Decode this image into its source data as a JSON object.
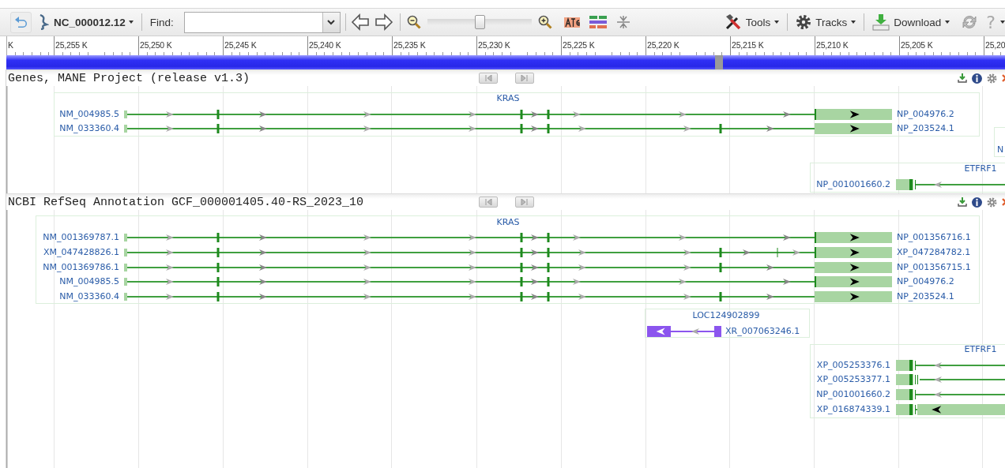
{
  "toolbar": {
    "sequence": "NC_000012.12",
    "find_label": "Find:",
    "zoom": {
      "level": 0.5
    },
    "menus": [
      "Tools",
      "Tracks",
      "Download"
    ],
    "help": "?"
  },
  "ruler": {
    "labels": [
      "K",
      "25,255 K",
      "25,250 K",
      "25,245 K",
      "25,240 K",
      "25,235 K",
      "25,230 K",
      "25,225 K",
      "25,220 K",
      "25,215 K",
      "25,210 K",
      "25,205 K",
      "25,20"
    ]
  },
  "tracks": [
    {
      "title": "Genes, MANE Project (release v1.3)",
      "genes": [
        {
          "name": "KRAS",
          "transcripts": [
            {
              "kind": "typeA",
              "left_label": "NM_004985.5",
              "right_label": "NP_004976.2"
            },
            {
              "kind": "typeB",
              "left_label": "NM_033360.4",
              "right_label": "NP_203524.1"
            }
          ]
        },
        {
          "transcripts": [
            {
              "right_label": "N"
            }
          ]
        },
        {
          "name": "ETFRF1",
          "transcripts": [
            {
              "kind": "reverse",
              "left_label": "NP_001001660.2"
            }
          ]
        }
      ]
    },
    {
      "title": "NCBI RefSeq Annotation GCF_000001405.40-RS_2023_10",
      "genes": [
        {
          "name": "KRAS",
          "transcripts": [
            {
              "kind": "typeA",
              "left_label": "NM_001369787.1",
              "right_label": "NP_001356716.1"
            },
            {
              "kind": "typeC",
              "left_label": "XM_047428826.1",
              "right_label": "XP_047284782.1"
            },
            {
              "kind": "typeB",
              "left_label": "NM_001369786.1",
              "right_label": "NP_001356715.1"
            },
            {
              "kind": "typeA",
              "left_label": "NM_004985.5",
              "right_label": "NP_004976.2"
            },
            {
              "kind": "typeB",
              "left_label": "NM_033360.4",
              "right_label": "NP_203524.1"
            }
          ]
        },
        {
          "name": "LOC124902899",
          "transcripts": [
            {
              "kind": "noncoding",
              "right_label": "XR_007063246.1"
            }
          ]
        },
        {
          "name": "ETFRF1",
          "transcripts": [
            {
              "kind": "reverse",
              "left_label": "XP_005253376.1"
            },
            {
              "kind": "reverseSplit",
              "left_label": "XP_005253377.1"
            },
            {
              "kind": "reverse",
              "left_label": "NP_001001660.2"
            },
            {
              "kind": "reverseCoding",
              "left_label": "XP_016874339.1"
            }
          ]
        }
      ]
    }
  ]
}
